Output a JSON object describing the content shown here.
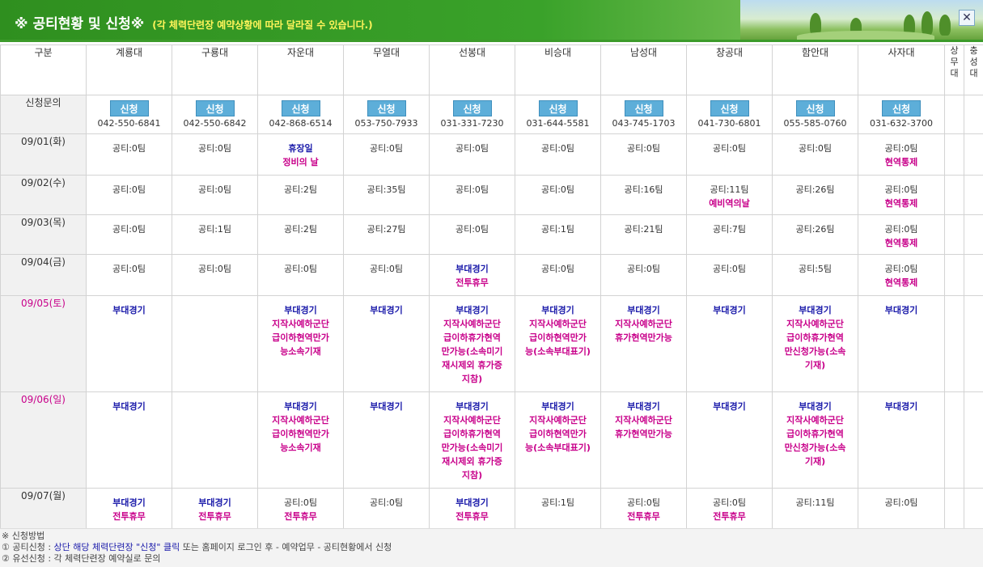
{
  "header": {
    "title": "※ 공티현황 및 신청※",
    "subtitle": "(각 체력단련장 예약상황에 따라 달라질 수 있습니다.)",
    "close_label": "✕"
  },
  "table": {
    "col_label_header": "구분",
    "columns": [
      "계룡대",
      "구룡대",
      "자운대",
      "무열대",
      "선봉대",
      "비승대",
      "남성대",
      "창공대",
      "함안대",
      "사자대",
      "상무대",
      "충성대"
    ],
    "apply_row_label": "신청문의",
    "apply_button_label": "신청",
    "phones": [
      "042-550-6841",
      "042-550-6842",
      "042-868-6514",
      "053-750-7933",
      "031-331-7230",
      "031-644-5581",
      "043-745-1703",
      "041-730-6801",
      "055-585-0760",
      "031-632-3700",
      "",
      ""
    ],
    "rows": [
      {
        "date": "09/01(화)",
        "weekend": false,
        "cells": [
          [
            {
              "t": "공티:0팀",
              "c": "txt"
            }
          ],
          [
            {
              "t": "공티:0팀",
              "c": "txt"
            }
          ],
          [
            {
              "t": "휴장일",
              "c": "blue"
            },
            {
              "t": "정비의 날",
              "c": "pink"
            }
          ],
          [
            {
              "t": "공티:0팀",
              "c": "txt"
            }
          ],
          [
            {
              "t": "공티:0팀",
              "c": "txt"
            }
          ],
          [
            {
              "t": "공티:0팀",
              "c": "txt"
            }
          ],
          [
            {
              "t": "공티:0팀",
              "c": "txt"
            }
          ],
          [
            {
              "t": "공티:0팀",
              "c": "txt"
            }
          ],
          [
            {
              "t": "공티:0팀",
              "c": "txt"
            }
          ],
          [
            {
              "t": "공티:0팀",
              "c": "txt"
            },
            {
              "t": "현역통제",
              "c": "pink"
            }
          ],
          [],
          []
        ]
      },
      {
        "date": "09/02(수)",
        "weekend": false,
        "cells": [
          [
            {
              "t": "공티:0팀",
              "c": "txt"
            }
          ],
          [
            {
              "t": "공티:0팀",
              "c": "txt"
            }
          ],
          [
            {
              "t": "공티:2팀",
              "c": "txt"
            }
          ],
          [
            {
              "t": "공티:35팀",
              "c": "txt"
            }
          ],
          [
            {
              "t": "공티:0팀",
              "c": "txt"
            }
          ],
          [
            {
              "t": "공티:0팀",
              "c": "txt"
            }
          ],
          [
            {
              "t": "공티:16팀",
              "c": "txt"
            }
          ],
          [
            {
              "t": "공티:11팀",
              "c": "txt"
            },
            {
              "t": "예비역의날",
              "c": "pink"
            }
          ],
          [
            {
              "t": "공티:26팀",
              "c": "txt"
            }
          ],
          [
            {
              "t": "공티:0팀",
              "c": "txt"
            },
            {
              "t": "현역통제",
              "c": "pink"
            }
          ],
          [],
          []
        ]
      },
      {
        "date": "09/03(목)",
        "weekend": false,
        "cells": [
          [
            {
              "t": "공티:0팀",
              "c": "txt"
            }
          ],
          [
            {
              "t": "공티:1팀",
              "c": "txt"
            }
          ],
          [
            {
              "t": "공티:2팀",
              "c": "txt"
            }
          ],
          [
            {
              "t": "공티:27팀",
              "c": "txt"
            }
          ],
          [
            {
              "t": "공티:0팀",
              "c": "txt"
            }
          ],
          [
            {
              "t": "공티:1팀",
              "c": "txt"
            }
          ],
          [
            {
              "t": "공티:21팀",
              "c": "txt"
            }
          ],
          [
            {
              "t": "공티:7팀",
              "c": "txt"
            }
          ],
          [
            {
              "t": "공티:26팀",
              "c": "txt"
            }
          ],
          [
            {
              "t": "공티:0팀",
              "c": "txt"
            },
            {
              "t": "현역통제",
              "c": "pink"
            }
          ],
          [],
          []
        ]
      },
      {
        "date": "09/04(금)",
        "weekend": false,
        "cells": [
          [
            {
              "t": "공티:0팀",
              "c": "txt"
            }
          ],
          [
            {
              "t": "공티:0팀",
              "c": "txt"
            }
          ],
          [
            {
              "t": "공티:0팀",
              "c": "txt"
            }
          ],
          [
            {
              "t": "공티:0팀",
              "c": "txt"
            }
          ],
          [
            {
              "t": "부대경기",
              "c": "blue"
            },
            {
              "t": "전투휴무",
              "c": "pink"
            }
          ],
          [
            {
              "t": "공티:0팀",
              "c": "txt"
            }
          ],
          [
            {
              "t": "공티:0팀",
              "c": "txt"
            }
          ],
          [
            {
              "t": "공티:0팀",
              "c": "txt"
            }
          ],
          [
            {
              "t": "공티:5팀",
              "c": "txt"
            }
          ],
          [
            {
              "t": "공티:0팀",
              "c": "txt"
            },
            {
              "t": "현역통제",
              "c": "pink"
            }
          ],
          [],
          []
        ]
      },
      {
        "date": "09/05(토)",
        "weekend": true,
        "cells": [
          [
            {
              "t": "부대경기",
              "c": "blue"
            }
          ],
          [],
          [
            {
              "t": "부대경기",
              "c": "blue"
            },
            {
              "t": "지작사예하군단",
              "c": "pink"
            },
            {
              "t": "급이하현역만가",
              "c": "pink"
            },
            {
              "t": "능소속기재",
              "c": "pink"
            }
          ],
          [
            {
              "t": "부대경기",
              "c": "blue"
            }
          ],
          [
            {
              "t": "부대경기",
              "c": "blue"
            },
            {
              "t": "지작사예하군단",
              "c": "pink"
            },
            {
              "t": "급이하휴가현역",
              "c": "pink"
            },
            {
              "t": "만가능(소속미기",
              "c": "pink"
            },
            {
              "t": "재시제외 휴가증",
              "c": "pink"
            },
            {
              "t": "지참)",
              "c": "pink"
            }
          ],
          [
            {
              "t": "부대경기",
              "c": "blue"
            },
            {
              "t": "지작사예하군단",
              "c": "pink"
            },
            {
              "t": "급이하현역만가",
              "c": "pink"
            },
            {
              "t": "능(소속부대표기)",
              "c": "pink"
            }
          ],
          [
            {
              "t": "부대경기",
              "c": "blue"
            },
            {
              "t": "지작사예하군단",
              "c": "pink"
            },
            {
              "t": "휴가현역만가능",
              "c": "pink"
            }
          ],
          [
            {
              "t": "부대경기",
              "c": "blue"
            }
          ],
          [
            {
              "t": "부대경기",
              "c": "blue"
            },
            {
              "t": "지작사예하군단",
              "c": "pink"
            },
            {
              "t": "급이하휴가현역",
              "c": "pink"
            },
            {
              "t": "만신청가능(소속",
              "c": "pink"
            },
            {
              "t": "기재)",
              "c": "pink"
            }
          ],
          [
            {
              "t": "부대경기",
              "c": "blue"
            }
          ],
          [],
          []
        ]
      },
      {
        "date": "09/06(일)",
        "weekend": true,
        "cells": [
          [
            {
              "t": "부대경기",
              "c": "blue"
            }
          ],
          [],
          [
            {
              "t": "부대경기",
              "c": "blue"
            },
            {
              "t": "지작사예하군단",
              "c": "pink"
            },
            {
              "t": "급이하현역만가",
              "c": "pink"
            },
            {
              "t": "능소속기재",
              "c": "pink"
            }
          ],
          [
            {
              "t": "부대경기",
              "c": "blue"
            }
          ],
          [
            {
              "t": "부대경기",
              "c": "blue"
            },
            {
              "t": "지작사예하군단",
              "c": "pink"
            },
            {
              "t": "급이하휴가현역",
              "c": "pink"
            },
            {
              "t": "만가능(소속미기",
              "c": "pink"
            },
            {
              "t": "재시제외 휴가증",
              "c": "pink"
            },
            {
              "t": "지참)",
              "c": "pink"
            }
          ],
          [
            {
              "t": "부대경기",
              "c": "blue"
            },
            {
              "t": "지작사예하군단",
              "c": "pink"
            },
            {
              "t": "급이하현역만가",
              "c": "pink"
            },
            {
              "t": "능(소속부대표기)",
              "c": "pink"
            }
          ],
          [
            {
              "t": "부대경기",
              "c": "blue"
            },
            {
              "t": "지작사예하군단",
              "c": "pink"
            },
            {
              "t": "휴가현역만가능",
              "c": "pink"
            }
          ],
          [
            {
              "t": "부대경기",
              "c": "blue"
            }
          ],
          [
            {
              "t": "부대경기",
              "c": "blue"
            },
            {
              "t": "지작사예하군단",
              "c": "pink"
            },
            {
              "t": "급이하휴가현역",
              "c": "pink"
            },
            {
              "t": "만신청가능(소속",
              "c": "pink"
            },
            {
              "t": "기재)",
              "c": "pink"
            }
          ],
          [
            {
              "t": "부대경기",
              "c": "blue"
            }
          ],
          [],
          []
        ]
      },
      {
        "date": "09/07(월)",
        "weekend": false,
        "cells": [
          [
            {
              "t": "부대경기",
              "c": "blue"
            },
            {
              "t": "전투휴무",
              "c": "pink"
            }
          ],
          [
            {
              "t": "부대경기",
              "c": "blue"
            },
            {
              "t": "전투휴무",
              "c": "pink"
            }
          ],
          [
            {
              "t": "공티:0팀",
              "c": "txt"
            },
            {
              "t": "전투휴무",
              "c": "pink"
            }
          ],
          [
            {
              "t": "공티:0팀",
              "c": "txt"
            }
          ],
          [
            {
              "t": "부대경기",
              "c": "blue"
            },
            {
              "t": "전투휴무",
              "c": "pink"
            }
          ],
          [
            {
              "t": "공티:1팀",
              "c": "txt"
            }
          ],
          [
            {
              "t": "공티:0팀",
              "c": "txt"
            },
            {
              "t": "전투휴무",
              "c": "pink"
            }
          ],
          [
            {
              "t": "공티:0팀",
              "c": "txt"
            },
            {
              "t": "전투휴무",
              "c": "pink"
            }
          ],
          [
            {
              "t": "공티:11팀",
              "c": "txt"
            }
          ],
          [
            {
              "t": "공티:0팀",
              "c": "txt"
            }
          ],
          [],
          []
        ]
      }
    ]
  },
  "footer": {
    "line1": "※ 신청방법",
    "line2_prefix": "① 공티신청 : ",
    "line2_highlight": "상단 해당 체력단련장 \"신청\" 클릭",
    "line2_suffix": " 또는 홈페이지 로그인 후 - 예약업무 - 공티현황에서 신청",
    "line3": "② 유선신청 : 각 체력단련장 예약실로 문의"
  },
  "colors": {
    "header_green": "#3aa22a",
    "subtitle_yellow": "#fff45a",
    "apply_button": "#5daed9",
    "label_blue": "#1a1aaa",
    "label_pink": "#c8008a",
    "first_col_bg": "#f1f1f1"
  }
}
